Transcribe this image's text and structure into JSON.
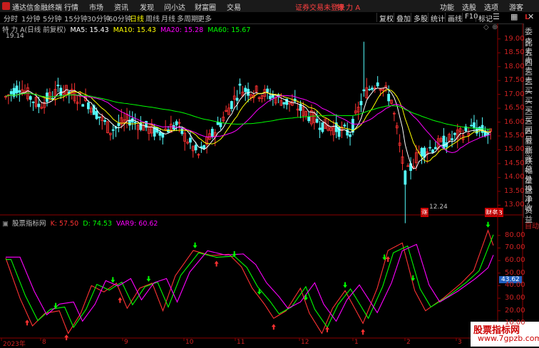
{
  "topbar": {
    "app_title": "通达信金融终端",
    "menus": [
      "行情",
      "市场",
      "资讯",
      "发现",
      "问小达",
      "财富圈",
      "交易"
    ],
    "warning": "证券交易未登录",
    "stock": "特 力 A",
    "buttons": [
      "功能",
      "选股",
      "选项",
      "游客"
    ]
  },
  "tabs": {
    "periods": [
      "分时",
      "1分钟",
      "5分钟",
      "15分钟",
      "30分钟",
      "60分钟",
      "日线",
      "周线",
      "月线",
      "多周期",
      "更多"
    ],
    "active": "日线",
    "right_buttons": [
      "复权",
      "叠加",
      "多股",
      "统计",
      "画线",
      "F10",
      "标记"
    ]
  },
  "main_legend": {
    "title": "特 力 A(日线 前复权)",
    "ma5": "MA5: 15.43",
    "ma10": "MA10: 15.43",
    "ma20": "MA20: 15.28",
    "ma60": "MA60: 15.67"
  },
  "price_axis": [
    "19.00",
    "18.50",
    "18.00",
    "17.50",
    "17.00",
    "16.50",
    "16.00",
    "15.50",
    "15.00",
    "14.50",
    "14.00",
    "13.50",
    "13.00"
  ],
  "annotations": {
    "high": "19.14",
    "low": "12.24",
    "label_low": "涨",
    "label_right": "财务3"
  },
  "quote_column": [
    "委比",
    "卖五",
    "卖四",
    "卖三",
    "卖二",
    "卖一",
    "买一",
    "买二",
    "买三",
    "买四",
    "买五",
    "最新",
    "涨跌",
    "涨幅",
    "总量",
    "外盘",
    "换手",
    "净资",
    "收益"
  ],
  "ind_legend": {
    "name": "股票指标网",
    "k": "K: 57.50",
    "d": "D: 74.53",
    "var9": "VAR9: 60.62"
  },
  "ind_axis": [
    "80.00",
    "70.00",
    "60.00",
    "50.00",
    "40.00",
    "30.00",
    "20.00",
    "10.00"
  ],
  "ind_axis_right": "自动",
  "ind_badge": "43.62",
  "x_axis": [
    "2023年",
    "8",
    "9",
    "10",
    "11",
    "12",
    "1",
    "2",
    "3"
  ],
  "watermark": {
    "line1": "股票指标网",
    "line2": "www.7gpzb.com"
  },
  "chart_data": {
    "type": "candlestick+line",
    "price_range": [
      12.24,
      19.14
    ],
    "ma_values": {
      "MA5": 15.43,
      "MA10": 15.43,
      "MA20": 15.28,
      "MA60": 15.67
    },
    "kdj": {
      "K": 57.5,
      "D": 74.53,
      "VAR9": 60.62
    },
    "indicator_range": [
      0,
      85
    ]
  },
  "colors": {
    "up": "#ff3232",
    "down": "#54fcfc",
    "ma5": "#ffffff",
    "ma10": "#ffff00",
    "ma20": "#ff00ff",
    "ma60": "#00ff00"
  }
}
